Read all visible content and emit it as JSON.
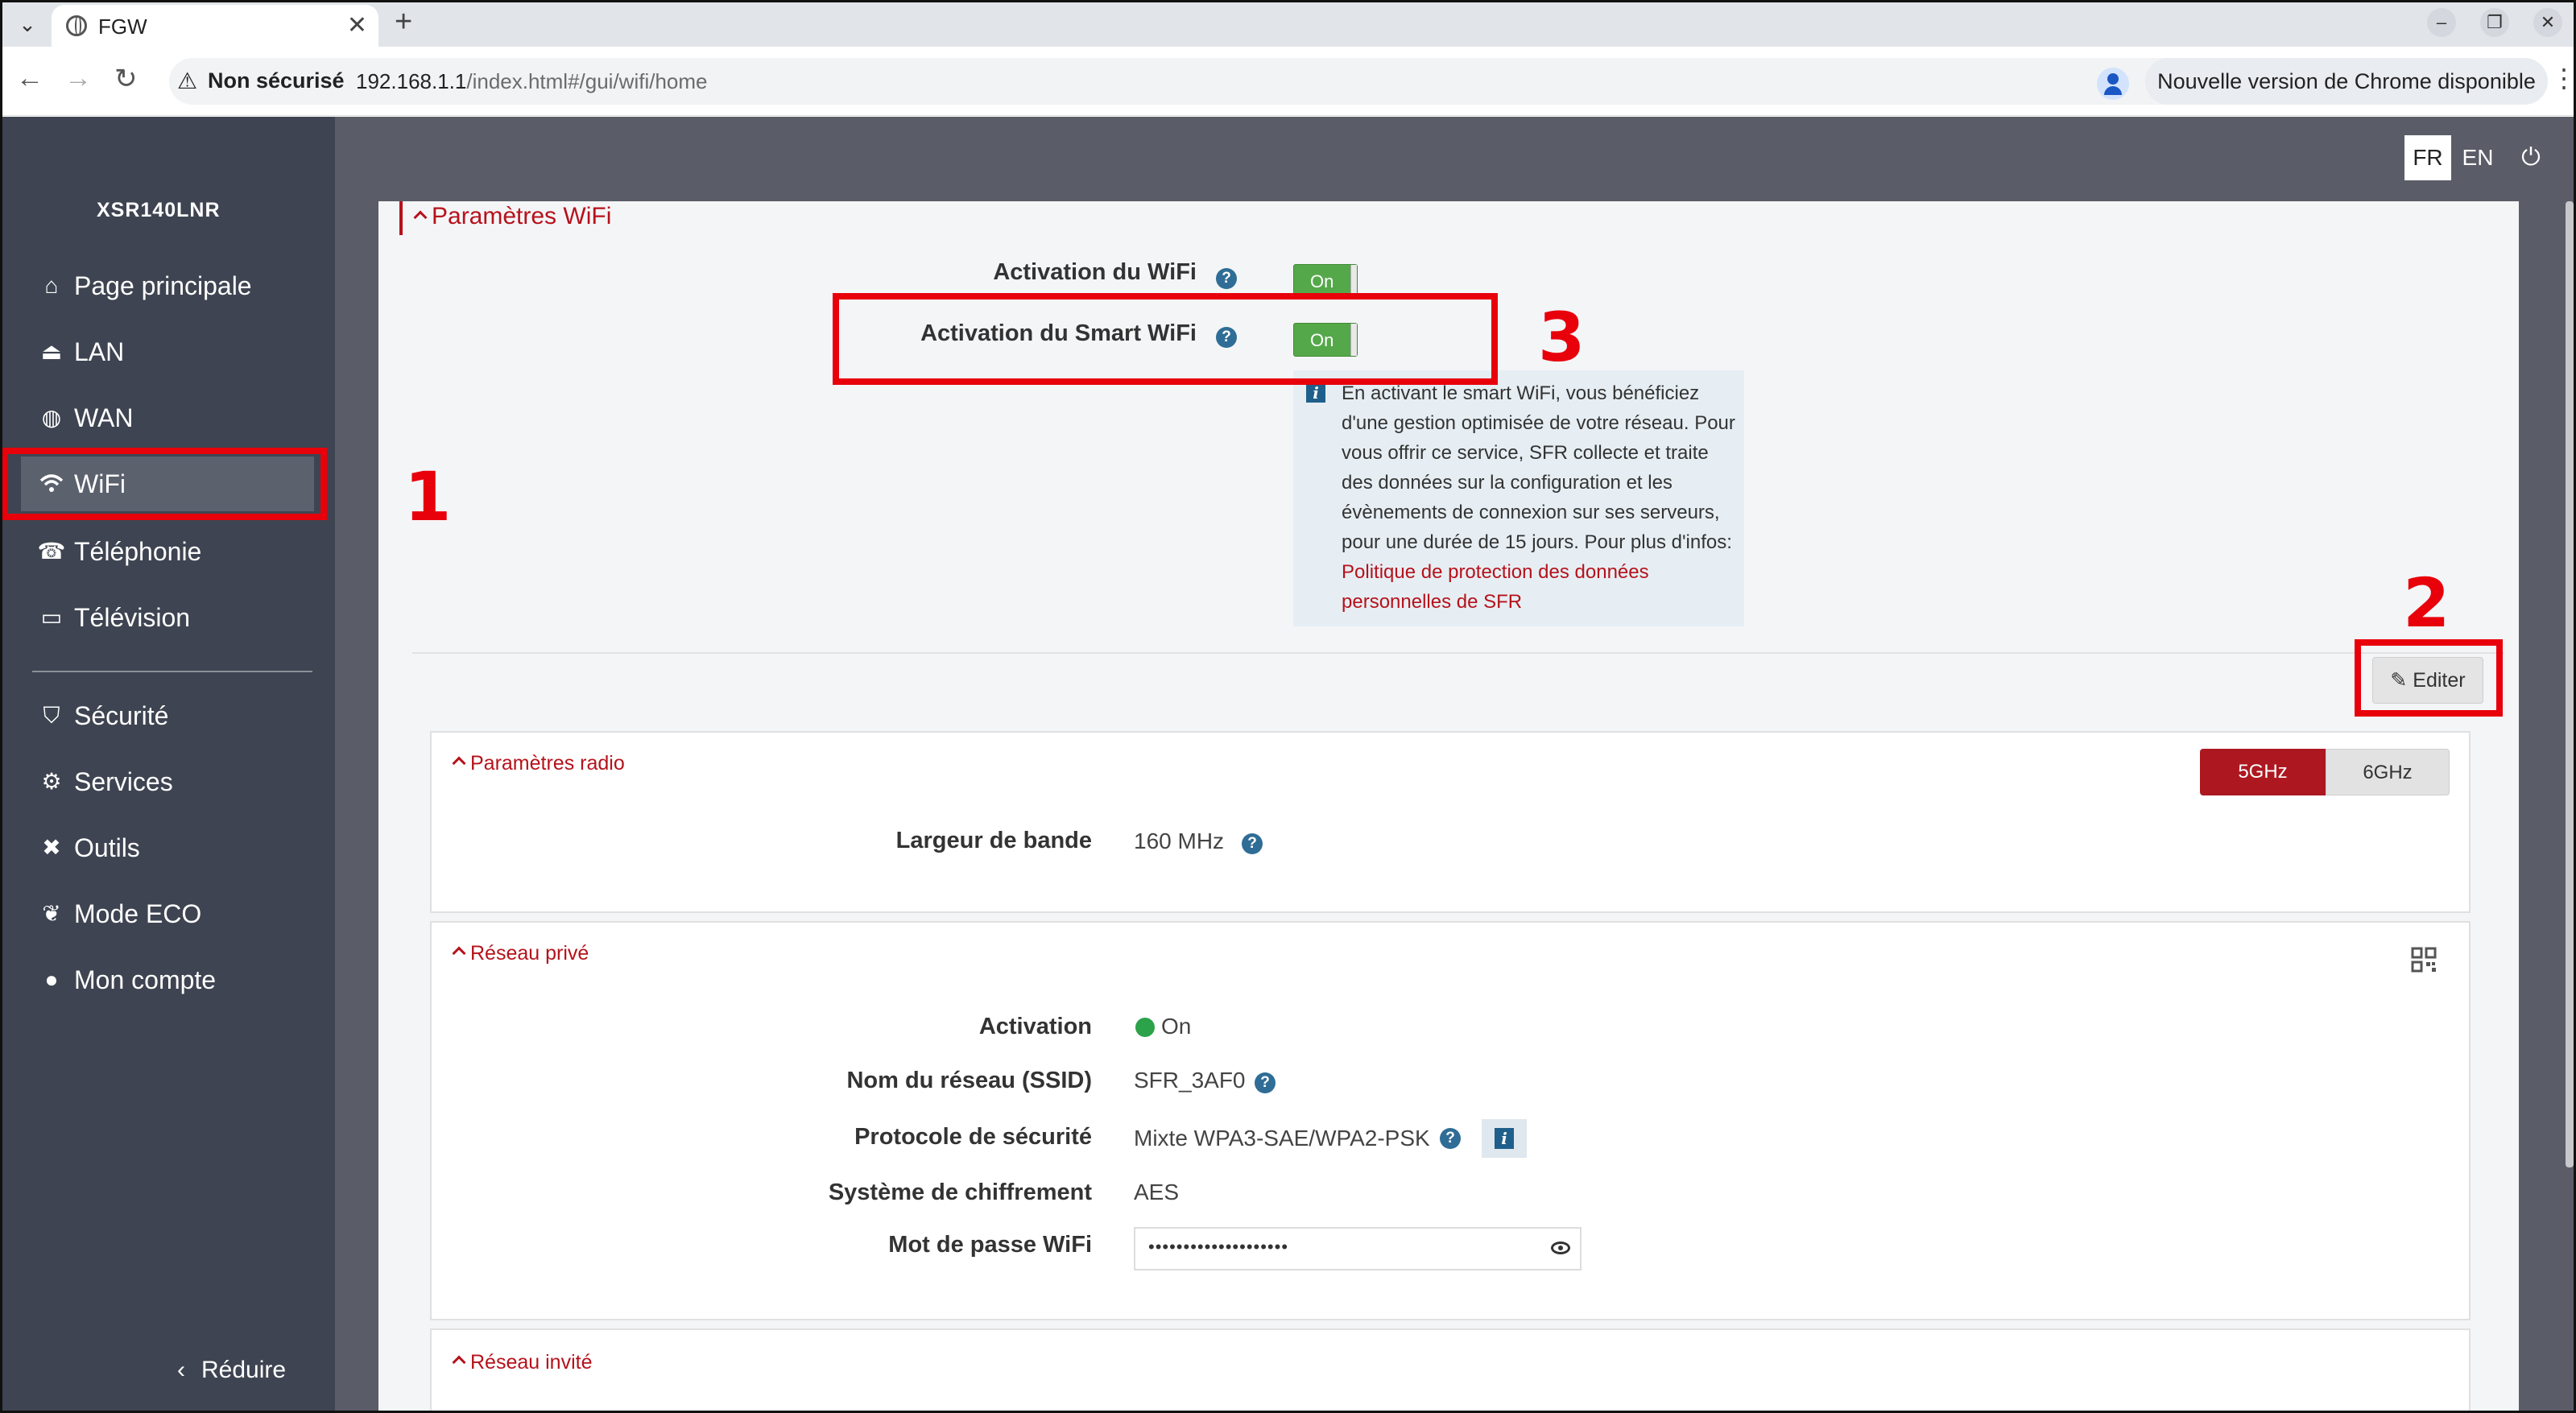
{
  "browser": {
    "tab_title": "FGW",
    "security_label": "Non sécurisé",
    "url_host": "192.168.1.1",
    "url_path": "/index.html#/gui/wifi/home",
    "update_label": "Nouvelle version de Chrome disponible"
  },
  "sidebar": {
    "model": "XSR140LNR",
    "items": [
      {
        "label": "Page principale",
        "icon": "home-icon"
      },
      {
        "label": "LAN",
        "icon": "lan-icon"
      },
      {
        "label": "WAN",
        "icon": "globe-icon"
      },
      {
        "label": "WiFi",
        "icon": "wifi-icon",
        "active": true
      },
      {
        "label": "Téléphonie",
        "icon": "phone-icon"
      },
      {
        "label": "Télévision",
        "icon": "tv-icon"
      },
      {
        "label": "Sécurité",
        "icon": "shield-icon"
      },
      {
        "label": "Services",
        "icon": "gears-icon"
      },
      {
        "label": "Outils",
        "icon": "tools-icon"
      },
      {
        "label": "Mode ECO",
        "icon": "leaf-icon"
      },
      {
        "label": "Mon compte",
        "icon": "user-icon"
      }
    ],
    "reduce_label": "Réduire"
  },
  "header": {
    "lang_fr": "FR",
    "lang_en": "EN"
  },
  "wifi_params": {
    "title": "Paramètres WiFi",
    "wifi_activation_label": "Activation du WiFi",
    "wifi_activation_value": "On",
    "smart_wifi_label": "Activation du Smart WiFi",
    "smart_wifi_value": "On",
    "info_text": "En activant le smart WiFi, vous bénéficiez d'une gestion optimisée de votre réseau. Pour vous offrir ce service, SFR collecte et traite des données sur la configuration et les évènements de connexion sur ses serveurs, pour une durée de 15 jours. Pour plus d'infos: ",
    "info_link": "Politique de protection des données personnelles de SFR",
    "edit_label": "Editer"
  },
  "radio": {
    "title": "Paramètres radio",
    "band_5": "5GHz",
    "band_6": "6GHz",
    "bandwidth_label": "Largeur de bande",
    "bandwidth_value": "160 MHz"
  },
  "private_network": {
    "title": "Réseau privé",
    "activation_label": "Activation",
    "activation_value": "On",
    "ssid_label": "Nom du réseau (SSID)",
    "ssid_value": "SFR_3AF0",
    "security_label": "Protocole de sécurité",
    "security_value": "Mixte WPA3-SAE/WPA2-PSK",
    "encryption_label": "Système de chiffrement",
    "encryption_value": "AES",
    "password_label": "Mot de passe WiFi",
    "password_value": "••••••••••••••••••••"
  },
  "guest_network": {
    "title": "Réseau invité"
  },
  "annotations": {
    "n1": "1",
    "n2": "2",
    "n3": "3"
  },
  "colors": {
    "accent": "#b6121b",
    "sidebar_bg": "#3e4451",
    "toggle_on": "#55a84a",
    "annotation": "#e8000b"
  }
}
